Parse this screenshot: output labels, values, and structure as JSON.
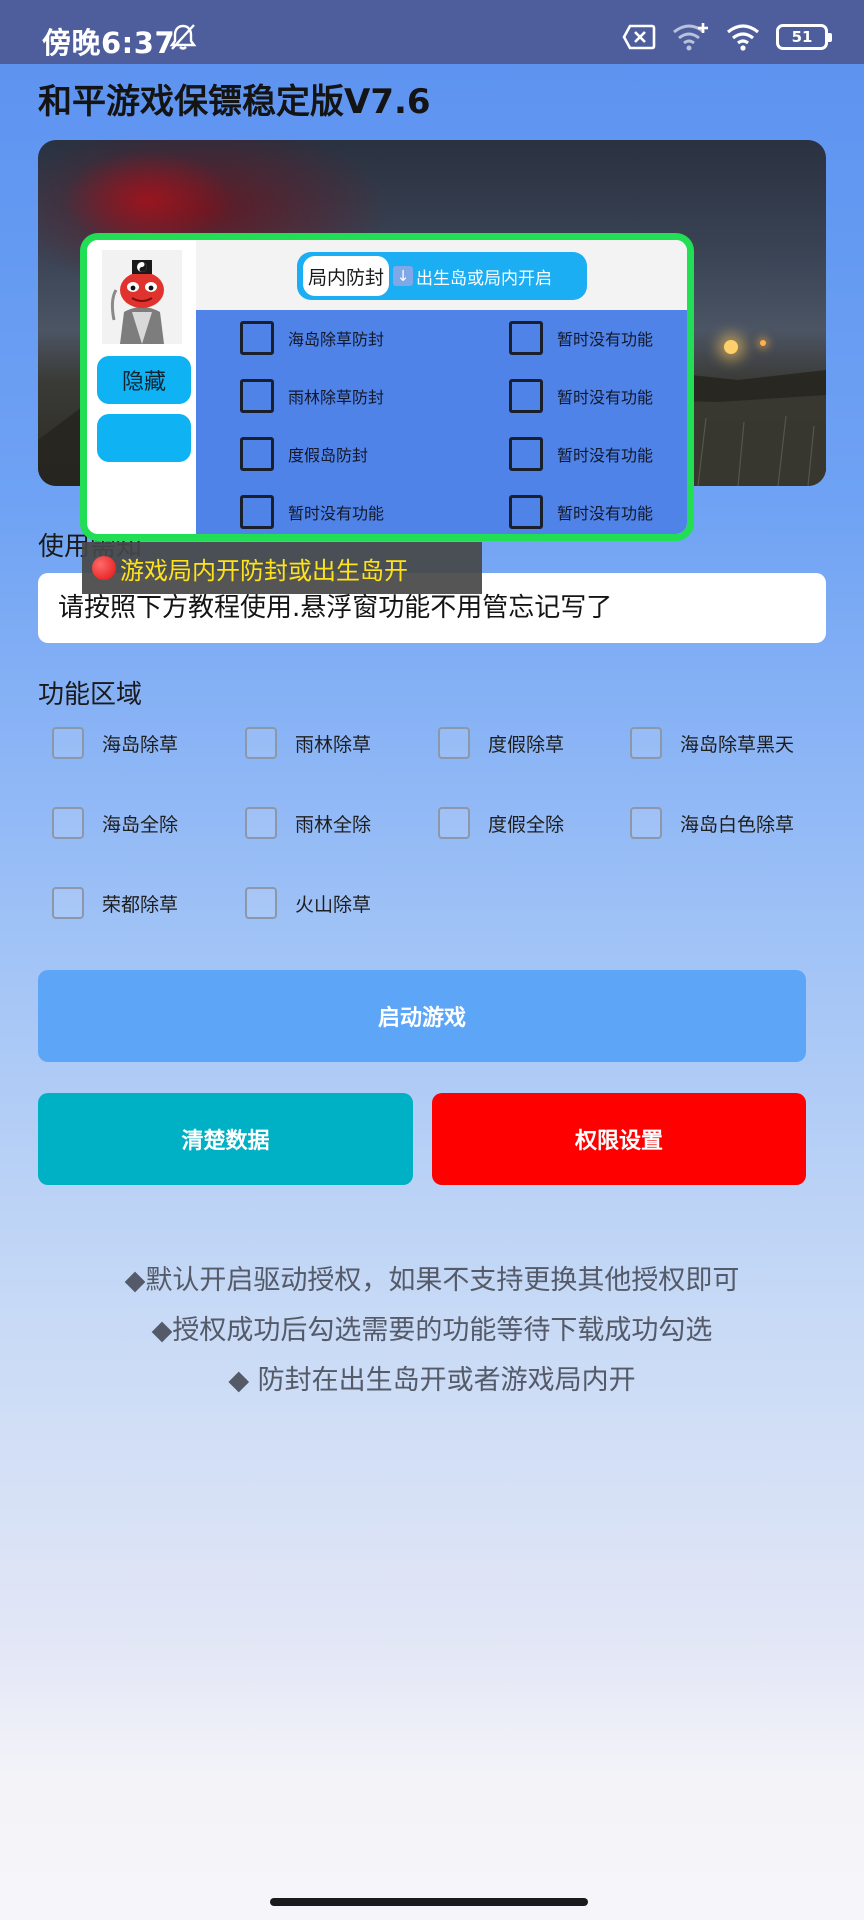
{
  "status_bar": {
    "time": "傍晚6:37",
    "battery": "51",
    "icons": [
      "bell-off-icon",
      "sim-error-icon",
      "wifi-plus-icon",
      "wifi-icon",
      "battery-icon"
    ]
  },
  "app": {
    "title": "和平游戏保镖稳定版V7.6"
  },
  "floating_window": {
    "hide_label": "隐藏",
    "tab_label": "局内防封",
    "tab_note": "出生岛或局内开启",
    "items": [
      "海岛除草防封",
      "暂时没有功能",
      "雨林除草防封",
      "暂时没有功能",
      "度假岛防封",
      "暂时没有功能",
      "暂时没有功能",
      "暂时没有功能"
    ]
  },
  "toast": {
    "text": "游戏局内开防封或出生岛开"
  },
  "usage": {
    "label": "使用需知",
    "text": "请按照下方教程使用.悬浮窗功能不用管忘记写了"
  },
  "functions": {
    "label": "功能区域",
    "items": [
      "海岛除草",
      "雨林除草",
      "度假除草",
      "海岛除草黑天",
      "海岛全除",
      "雨林全除",
      "度假全除",
      "海岛白色除草",
      "荣都除草",
      "火山除草"
    ]
  },
  "buttons": {
    "start": "启动游戏",
    "clear": "清楚数据",
    "permission": "权限设置"
  },
  "notes": [
    "◆默认开启驱动授权，如果不支持更换其他授权即可",
    "◆授权成功后勾选需要的功能等待下载成功勾选",
    "◆ 防封在出生岛开或者游戏局内开"
  ],
  "colors": {
    "status_bar": "#4e5e9c",
    "start_button": "#5da6f7",
    "clear_button": "#00b1c6",
    "permission_button": "#ff0000",
    "float_border": "#22de55",
    "float_body": "#4f83e8",
    "toast_text": "#ffe31a"
  }
}
